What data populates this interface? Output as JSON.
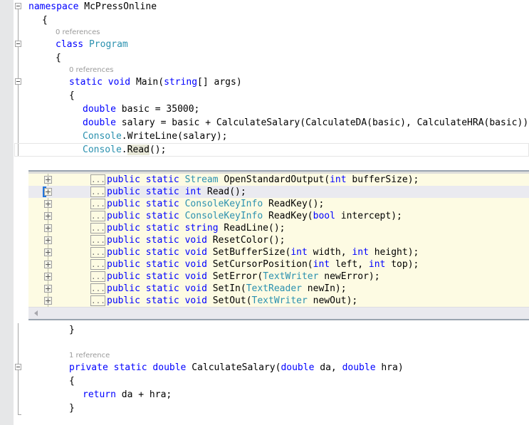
{
  "app": {
    "kind": "code-editor",
    "language": "csharp",
    "theme": "visual-studio-light"
  },
  "colors": {
    "keyword": "#0000ff",
    "type": "#2b91af",
    "plain": "#000000",
    "codelens": "#9a9a9a",
    "peek_background": "#fdfbe3",
    "peek_selected_row": "#eaeaf0",
    "peek_border": "#9aa4b0",
    "indicator_margin": "#e6e7e8",
    "selection_marker": "#2277dd",
    "word_highlight": "#e8e8d8"
  },
  "document": {
    "lines": [
      {
        "id": "l1",
        "indent": 0,
        "fold": "open",
        "segments": [
          {
            "t": "namespace ",
            "c": "kw"
          },
          {
            "t": "McPressOnline",
            "c": "pln"
          }
        ]
      },
      {
        "id": "l2",
        "indent": 1,
        "fold": "pipe",
        "segments": [
          {
            "t": "{",
            "c": "pln"
          }
        ]
      },
      {
        "id": "l3",
        "indent": 2,
        "fold": "pipe",
        "lens": "0 references"
      },
      {
        "id": "l4",
        "indent": 2,
        "fold": "open",
        "segments": [
          {
            "t": "class ",
            "c": "kw"
          },
          {
            "t": "Program",
            "c": "typ"
          }
        ]
      },
      {
        "id": "l5",
        "indent": 2,
        "fold": "pipe",
        "segments": [
          {
            "t": "{",
            "c": "pln"
          }
        ]
      },
      {
        "id": "l6",
        "indent": 3,
        "fold": "pipe",
        "lens": "0 references"
      },
      {
        "id": "l7",
        "indent": 3,
        "fold": "open",
        "segments": [
          {
            "t": "static ",
            "c": "kw"
          },
          {
            "t": "void ",
            "c": "kw"
          },
          {
            "t": "Main(",
            "c": "pln"
          },
          {
            "t": "string",
            "c": "kw"
          },
          {
            "t": "[] args)",
            "c": "pln"
          }
        ]
      },
      {
        "id": "l8",
        "indent": 3,
        "fold": "pipe",
        "segments": [
          {
            "t": "{",
            "c": "pln"
          }
        ]
      },
      {
        "id": "l9",
        "indent": 4,
        "fold": "pipe",
        "segments": [
          {
            "t": "double ",
            "c": "kw"
          },
          {
            "t": "basic = 35000;",
            "c": "pln"
          }
        ]
      },
      {
        "id": "l10",
        "indent": 4,
        "fold": "pipe",
        "segments": [
          {
            "t": "double ",
            "c": "kw"
          },
          {
            "t": "salary = basic + CalculateSalary(CalculateDA(basic), CalculateHRA(basic));",
            "c": "pln"
          }
        ]
      },
      {
        "id": "l11",
        "indent": 4,
        "fold": "pipe",
        "segments": [
          {
            "t": "Console",
            "c": "typ"
          },
          {
            "t": ".WriteLine(salary);",
            "c": "pln"
          }
        ]
      },
      {
        "id": "l12",
        "indent": 4,
        "fold": "pipe",
        "current": true,
        "segments": [
          {
            "t": "Console",
            "c": "typ"
          },
          {
            "t": ".",
            "c": "pln"
          },
          {
            "t": "Read",
            "c": "pln",
            "hl": true
          },
          {
            "t": "();",
            "c": "pln"
          }
        ]
      }
    ],
    "lines_after_peek": [
      {
        "id": "l13",
        "indent": 3,
        "fold": "pipe",
        "segments": [
          {
            "t": "}",
            "c": "pln"
          }
        ]
      },
      {
        "id": "l14",
        "indent": 0,
        "fold": "pipe",
        "segments": [
          {
            "t": "",
            "c": "pln"
          }
        ]
      },
      {
        "id": "l15",
        "indent": 3,
        "fold": "pipe",
        "lens": "1 reference"
      },
      {
        "id": "l16",
        "indent": 3,
        "fold": "open",
        "segments": [
          {
            "t": "private ",
            "c": "kw"
          },
          {
            "t": "static ",
            "c": "kw"
          },
          {
            "t": "double ",
            "c": "kw"
          },
          {
            "t": "CalculateSalary(",
            "c": "pln"
          },
          {
            "t": "double ",
            "c": "kw"
          },
          {
            "t": "da, ",
            "c": "pln"
          },
          {
            "t": "double ",
            "c": "kw"
          },
          {
            "t": "hra)",
            "c": "pln"
          }
        ]
      },
      {
        "id": "l17",
        "indent": 3,
        "fold": "pipe",
        "segments": [
          {
            "t": "{",
            "c": "pln"
          }
        ]
      },
      {
        "id": "l18",
        "indent": 4,
        "fold": "pipe",
        "segments": [
          {
            "t": "return ",
            "c": "kw"
          },
          {
            "t": "da + hra;",
            "c": "pln"
          }
        ]
      },
      {
        "id": "l19",
        "indent": 3,
        "fold": "endcap",
        "segments": [
          {
            "t": "}",
            "c": "pln"
          }
        ]
      }
    ]
  },
  "peek": {
    "ellipsis_label": "...",
    "rows": [
      {
        "id": "p1",
        "selected": false,
        "segments": [
          {
            "t": "public ",
            "c": "kw"
          },
          {
            "t": "static ",
            "c": "kw"
          },
          {
            "t": "Stream ",
            "c": "typ"
          },
          {
            "t": "OpenStandardOutput(",
            "c": "pln"
          },
          {
            "t": "int ",
            "c": "kw"
          },
          {
            "t": "bufferSize);",
            "c": "pln"
          }
        ]
      },
      {
        "id": "p2",
        "selected": true,
        "segments": [
          {
            "t": "public ",
            "c": "kw"
          },
          {
            "t": "static ",
            "c": "kw"
          },
          {
            "t": "int ",
            "c": "kw"
          },
          {
            "t": "Read();",
            "c": "pln"
          }
        ]
      },
      {
        "id": "p3",
        "selected": false,
        "segments": [
          {
            "t": "public ",
            "c": "kw"
          },
          {
            "t": "static ",
            "c": "kw"
          },
          {
            "t": "ConsoleKeyInfo ",
            "c": "typ"
          },
          {
            "t": "ReadKey();",
            "c": "pln"
          }
        ]
      },
      {
        "id": "p4",
        "selected": false,
        "segments": [
          {
            "t": "public ",
            "c": "kw"
          },
          {
            "t": "static ",
            "c": "kw"
          },
          {
            "t": "ConsoleKeyInfo ",
            "c": "typ"
          },
          {
            "t": "ReadKey(",
            "c": "pln"
          },
          {
            "t": "bool ",
            "c": "kw"
          },
          {
            "t": "intercept);",
            "c": "pln"
          }
        ]
      },
      {
        "id": "p5",
        "selected": false,
        "segments": [
          {
            "t": "public ",
            "c": "kw"
          },
          {
            "t": "static ",
            "c": "kw"
          },
          {
            "t": "string ",
            "c": "kw"
          },
          {
            "t": "ReadLine();",
            "c": "pln"
          }
        ]
      },
      {
        "id": "p6",
        "selected": false,
        "segments": [
          {
            "t": "public ",
            "c": "kw"
          },
          {
            "t": "static ",
            "c": "kw"
          },
          {
            "t": "void ",
            "c": "kw"
          },
          {
            "t": "ResetColor();",
            "c": "pln"
          }
        ]
      },
      {
        "id": "p7",
        "selected": false,
        "segments": [
          {
            "t": "public ",
            "c": "kw"
          },
          {
            "t": "static ",
            "c": "kw"
          },
          {
            "t": "void ",
            "c": "kw"
          },
          {
            "t": "SetBufferSize(",
            "c": "pln"
          },
          {
            "t": "int ",
            "c": "kw"
          },
          {
            "t": "width, ",
            "c": "pln"
          },
          {
            "t": "int ",
            "c": "kw"
          },
          {
            "t": "height);",
            "c": "pln"
          }
        ]
      },
      {
        "id": "p8",
        "selected": false,
        "segments": [
          {
            "t": "public ",
            "c": "kw"
          },
          {
            "t": "static ",
            "c": "kw"
          },
          {
            "t": "void ",
            "c": "kw"
          },
          {
            "t": "SetCursorPosition(",
            "c": "pln"
          },
          {
            "t": "int ",
            "c": "kw"
          },
          {
            "t": "left, ",
            "c": "pln"
          },
          {
            "t": "int ",
            "c": "kw"
          },
          {
            "t": "top);",
            "c": "pln"
          }
        ]
      },
      {
        "id": "p9",
        "selected": false,
        "segments": [
          {
            "t": "public ",
            "c": "kw"
          },
          {
            "t": "static ",
            "c": "kw"
          },
          {
            "t": "void ",
            "c": "kw"
          },
          {
            "t": "SetError(",
            "c": "pln"
          },
          {
            "t": "TextWriter ",
            "c": "typ"
          },
          {
            "t": "newError);",
            "c": "pln"
          }
        ]
      },
      {
        "id": "p10",
        "selected": false,
        "segments": [
          {
            "t": "public ",
            "c": "kw"
          },
          {
            "t": "static ",
            "c": "kw"
          },
          {
            "t": "void ",
            "c": "kw"
          },
          {
            "t": "SetIn(",
            "c": "pln"
          },
          {
            "t": "TextReader ",
            "c": "typ"
          },
          {
            "t": "newIn);",
            "c": "pln"
          }
        ]
      },
      {
        "id": "p11",
        "selected": false,
        "segments": [
          {
            "t": "public ",
            "c": "kw"
          },
          {
            "t": "static ",
            "c": "kw"
          },
          {
            "t": "void ",
            "c": "kw"
          },
          {
            "t": "SetOut(",
            "c": "pln"
          },
          {
            "t": "TextWriter ",
            "c": "typ"
          },
          {
            "t": "newOut);",
            "c": "pln"
          }
        ]
      }
    ],
    "scrollbar": {
      "name": "horizontal-scrollbar",
      "left_arrow_icon": "triangle-left-icon"
    }
  }
}
